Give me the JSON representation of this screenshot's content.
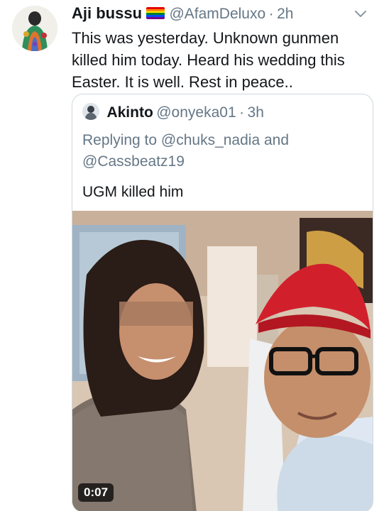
{
  "tweet": {
    "display_name": "Aji bussu",
    "handle": "@AfamDeluxo",
    "separator": "·",
    "time": "2h",
    "text": "This was yesterday. Unknown gunmen killed him today. Heard his wedding this Easter. It is well. Rest in peace..",
    "badge_icon": "rainbow-flag-icon",
    "menu_icon": "chevron-down-icon"
  },
  "quote": {
    "display_name": "Akinto",
    "handle": "@onyeka01",
    "separator": "·",
    "time": "3h",
    "replying_to": "Replying to @chuks_nadia and @Cassbeatz19",
    "text": "UGM killed him",
    "media": {
      "type": "video",
      "duration": "0:07"
    }
  },
  "colors": {
    "text": "#14171a",
    "secondary": "#657786",
    "border": "#cfd9de"
  }
}
